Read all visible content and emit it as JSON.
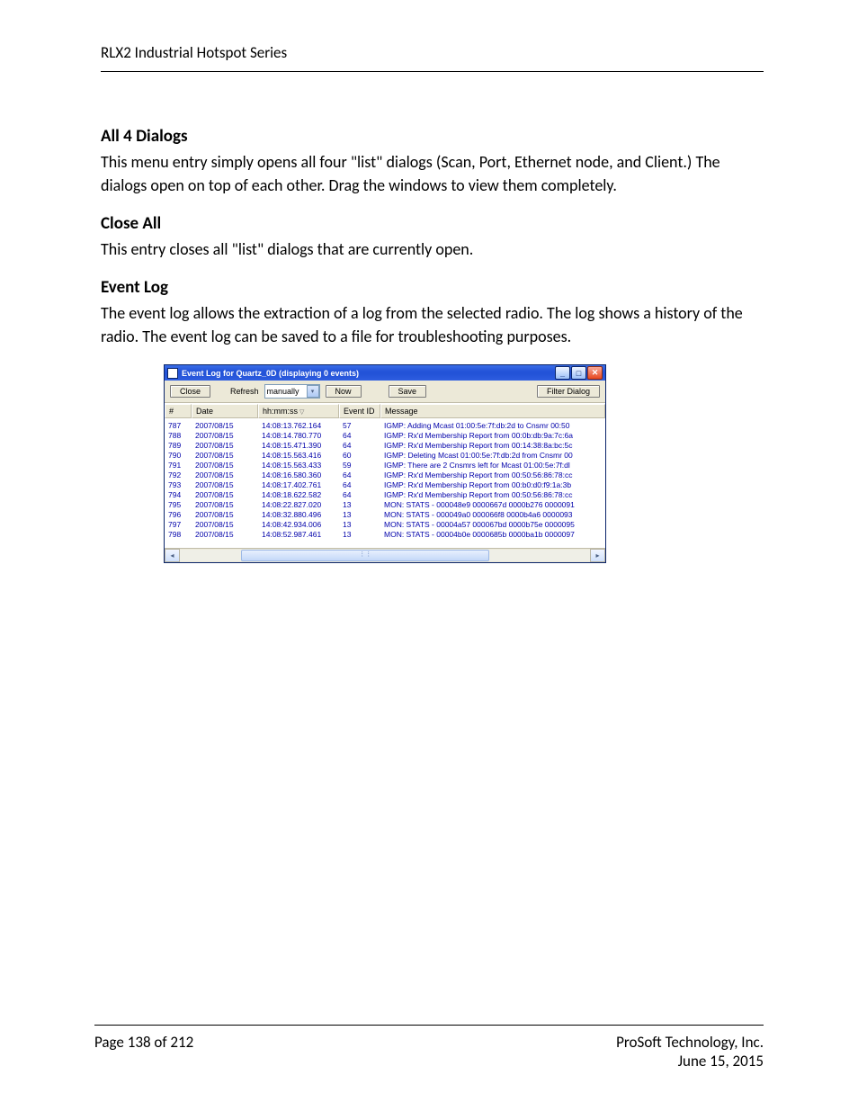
{
  "header": {
    "title": "RLX2 Industrial Hotspot Series"
  },
  "sections": {
    "a": {
      "heading": "All 4 Dialogs",
      "body": "This menu entry simply opens all four \"list\" dialogs (Scan, Port, Ethernet node, and Client.) The dialogs open on top of each other.  Drag the windows to view them completely."
    },
    "b": {
      "heading": "Close All",
      "body": "This entry closes all \"list\" dialogs that are currently open."
    },
    "c": {
      "heading": "Event Log",
      "body": "The event log allows the extraction of a log from the selected radio. The log shows a history of the radio. The event log can be saved to a file for troubleshooting purposes."
    }
  },
  "win": {
    "title": "Event Log for Quartz_0D (displaying 0 events)",
    "toolbar": {
      "close": "Close",
      "refresh": "Refresh",
      "mode_selected": "manually",
      "now": "Now",
      "save": "Save",
      "filter": "Filter Dialog"
    },
    "columns": {
      "num": "#",
      "date": "Date",
      "time": "hh:mm:ss",
      "eid": "Event ID",
      "msg": "Message"
    },
    "rows": [
      {
        "n": "787",
        "d": "2007/08/15",
        "t": "14:08:13.762.164",
        "e": "57",
        "m": "IGMP: Adding Mcast 01:00:5e:7f:db:2d to Cnsmr 00:50"
      },
      {
        "n": "788",
        "d": "2007/08/15",
        "t": "14:08:14.780.770",
        "e": "64",
        "m": "IGMP: Rx'd Membership Report from 00:0b:db:9a:7c:6a"
      },
      {
        "n": "789",
        "d": "2007/08/15",
        "t": "14:08:15.471.390",
        "e": "64",
        "m": "IGMP: Rx'd Membership Report from 00:14:38:8a:bc:5c"
      },
      {
        "n": "790",
        "d": "2007/08/15",
        "t": "14:08:15.563.416",
        "e": "60",
        "m": "IGMP: Deleting Mcast 01:00:5e:7f:db:2d from Cnsmr 00"
      },
      {
        "n": "791",
        "d": "2007/08/15",
        "t": "14:08:15.563.433",
        "e": "59",
        "m": "IGMP: There are 2 Cnsmrs left for Mcast 01:00:5e:7f:dl"
      },
      {
        "n": "792",
        "d": "2007/08/15",
        "t": "14:08:16.580.360",
        "e": "64",
        "m": "IGMP: Rx'd Membership Report from 00:50:56:86:78:cc"
      },
      {
        "n": "793",
        "d": "2007/08/15",
        "t": "14:08:17.402.761",
        "e": "64",
        "m": "IGMP: Rx'd Membership Report from 00:b0:d0:f9:1a:3b"
      },
      {
        "n": "794",
        "d": "2007/08/15",
        "t": "14:08:18.622.582",
        "e": "64",
        "m": "IGMP: Rx'd Membership Report from 00:50:56:86:78:cc"
      },
      {
        "n": "795",
        "d": "2007/08/15",
        "t": "14:08:22.827.020",
        "e": "13",
        "m": "MON: STATS - 000048e9 0000667d 0000b276 0000091"
      },
      {
        "n": "796",
        "d": "2007/08/15",
        "t": "14:08:32.880.496",
        "e": "13",
        "m": "MON: STATS - 000049a0 000066f8 0000b4a6 0000093"
      },
      {
        "n": "797",
        "d": "2007/08/15",
        "t": "14:08:42.934.006",
        "e": "13",
        "m": "MON: STATS - 00004a57 000067bd 0000b75e 0000095"
      },
      {
        "n": "798",
        "d": "2007/08/15",
        "t": "14:08:52.987.461",
        "e": "13",
        "m": "MON: STATS - 00004b0e 0000685b 0000ba1b 0000097"
      }
    ]
  },
  "footer": {
    "page": "Page 138 of 212",
    "company": "ProSoft Technology, Inc.",
    "date": "June 15, 2015"
  }
}
